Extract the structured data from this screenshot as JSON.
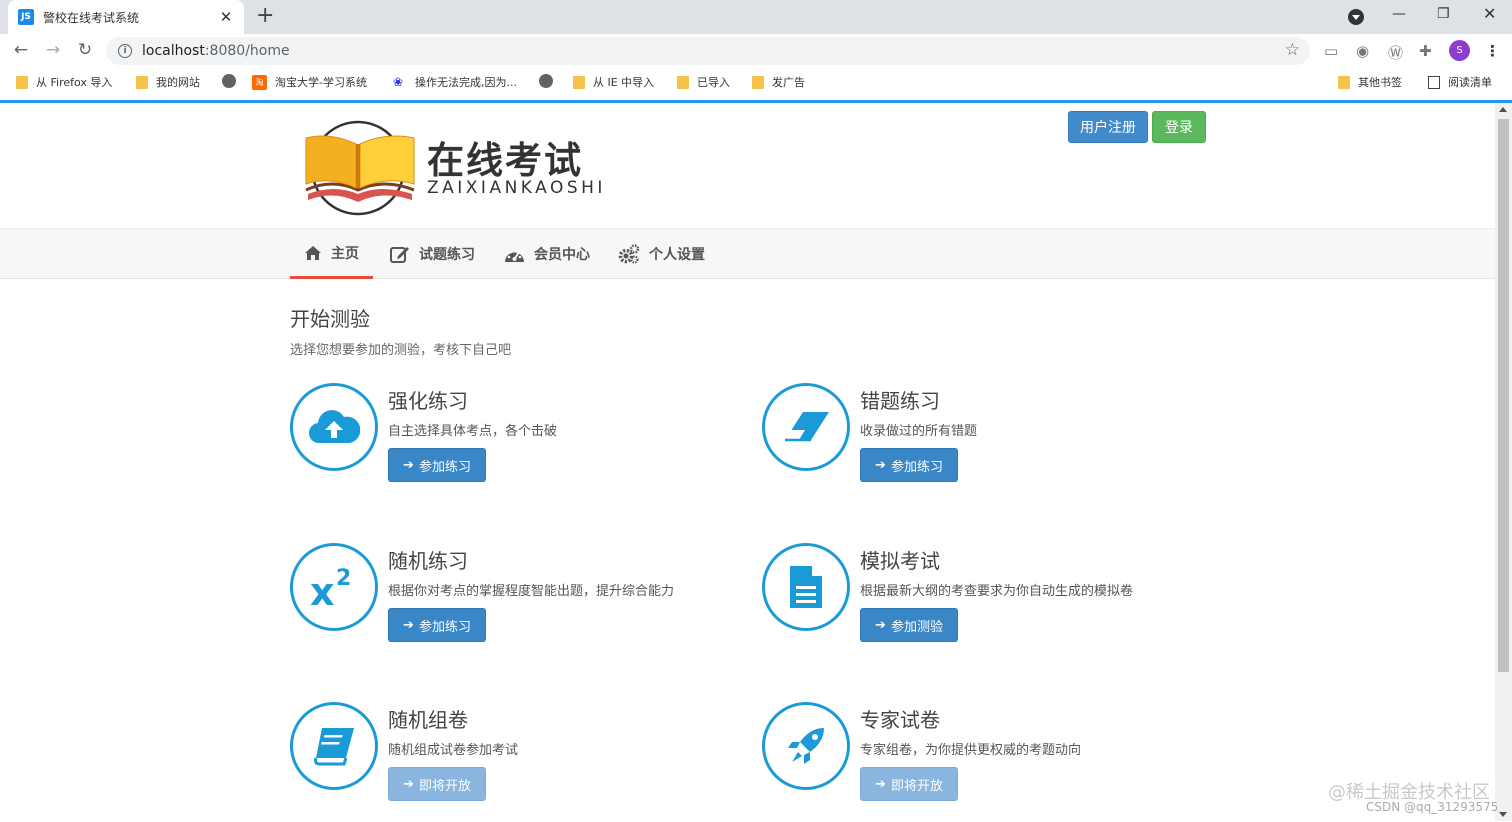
{
  "browser": {
    "tab_favicon": "JS",
    "tab_title": "警校在线考试系统",
    "url_host": "localhost",
    "url_path": ":8080/home",
    "avatar_letter": "S",
    "bookmarks": [
      {
        "icon": "folder",
        "label": "从 Firefox 导入"
      },
      {
        "icon": "folder",
        "label": "我的网站"
      },
      {
        "icon": "globe",
        "label": ""
      },
      {
        "icon": "taobao",
        "label": "淘宝大学-学习系统"
      },
      {
        "icon": "baidu",
        "label": "操作无法完成,因为..."
      },
      {
        "icon": "globe",
        "label": ""
      },
      {
        "icon": "folder",
        "label": "从 IE 中导入"
      },
      {
        "icon": "folder",
        "label": "已导入"
      },
      {
        "icon": "folder",
        "label": "发广告"
      }
    ],
    "other_bookmarks": "其他书签",
    "reading_list": "阅读清单"
  },
  "header": {
    "logo_title": "在线考试",
    "logo_sub": "ZAIXIANKAOSHI",
    "register_label": "用户注册",
    "login_label": "登录"
  },
  "nav": [
    {
      "label": "主页",
      "icon": "home-icon",
      "active": true
    },
    {
      "label": "试题练习",
      "icon": "edit-icon",
      "active": false
    },
    {
      "label": "会员中心",
      "icon": "dashboard-icon",
      "active": false
    },
    {
      "label": "个人设置",
      "icon": "gears-icon",
      "active": false
    }
  ],
  "main": {
    "title": "开始测验",
    "subtitle": "选择您想要参加的测验，考核下自己吧",
    "cards": [
      {
        "title": "强化练习",
        "desc": "自主选择具体考点，各个击破",
        "button": "参加练习",
        "icon": "cloud-upload-icon",
        "enabled": true
      },
      {
        "title": "错题练习",
        "desc": "收录做过的所有错题",
        "button": "参加练习",
        "icon": "eraser-icon",
        "enabled": true
      },
      {
        "title": "随机练习",
        "desc": "根据你对考点的掌握程度智能出题，提升综合能力",
        "button": "参加练习",
        "icon": "superscript-icon",
        "enabled": true
      },
      {
        "title": "模拟考试",
        "desc": "根据最新大纲的考查要求为你自动生成的模拟卷",
        "button": "参加测验",
        "icon": "document-icon",
        "enabled": true
      },
      {
        "title": "随机组卷",
        "desc": "随机组成试卷参加考试",
        "button": "即将开放",
        "icon": "book-icon",
        "enabled": false
      },
      {
        "title": "专家试卷",
        "desc": "专家组卷，为你提供更权威的考题动向",
        "button": "即将开放",
        "icon": "rocket-icon",
        "enabled": false
      }
    ]
  },
  "watermark": {
    "line1": "@稀土掘金技术社区",
    "line2": "CSDN @qq_31293575"
  },
  "colors": {
    "accent_blue": "#1b9ad8",
    "button_blue": "#3a87c8",
    "button_green": "#5cb85c",
    "nav_active": "#e74c3c"
  }
}
